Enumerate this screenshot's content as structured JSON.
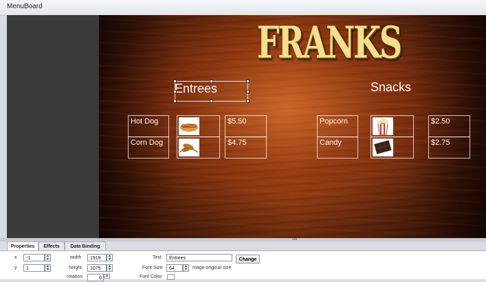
{
  "window": {
    "title": "MenuBoard"
  },
  "menu": {
    "brand": "FRANKS",
    "sections": [
      {
        "heading": "Entrees",
        "items": [
          {
            "name": "Hot Dog",
            "image": "hot-dog-icon",
            "price": "$5.50"
          },
          {
            "name": "Corn Dog",
            "image": "corn-dog-icon",
            "price": "$4.75"
          }
        ]
      },
      {
        "heading": "Snacks",
        "items": [
          {
            "name": "Popcorn",
            "image": "popcorn-icon",
            "price": "$2.50"
          },
          {
            "name": "Candy",
            "image": "candy-icon",
            "price": "$2.75"
          }
        ]
      }
    ]
  },
  "tabs": [
    "Properties",
    "Effects",
    "Data Binding"
  ],
  "properties": {
    "x_label": "x",
    "x_value": "-1",
    "y_label": "y",
    "y_value": "1",
    "width_label": "width",
    "width_value": "1919",
    "height_label": "height",
    "height_value": "1075",
    "rotation_label": "rotation",
    "rotation_value": "0",
    "text_label": "Text",
    "text_value": "Entrees",
    "change_label": "Change",
    "font_size_label": "Font Size",
    "font_size_value": "64",
    "image_note": "mage original size",
    "font_color_label": "Font Color"
  },
  "colors": {
    "brand_text": "#f3e08a",
    "menu_text": "#ffffff",
    "wood": "#8f3b12"
  }
}
